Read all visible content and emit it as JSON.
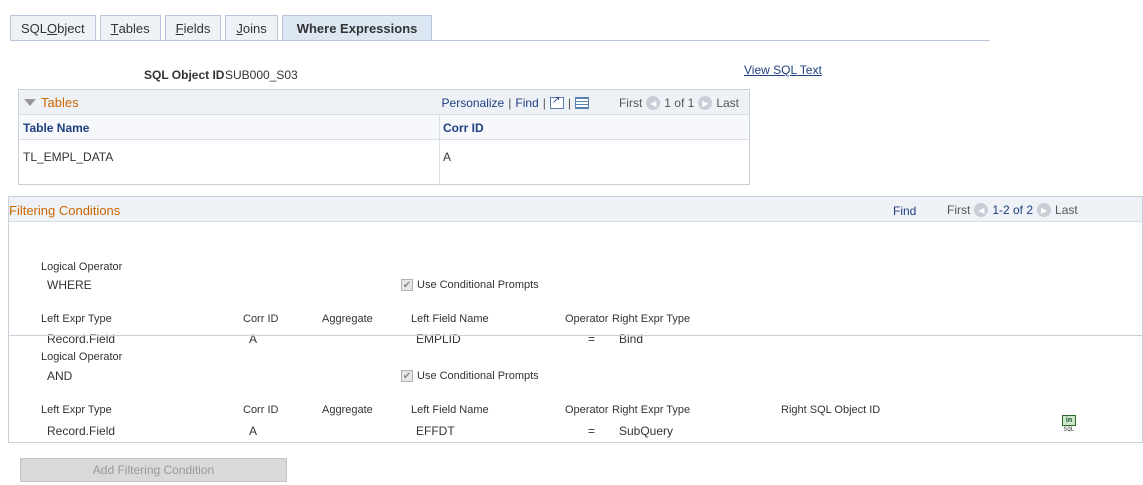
{
  "tabs": [
    {
      "pre": "SQL ",
      "u": "O",
      "post": "bject"
    },
    {
      "pre": "",
      "u": "T",
      "post": "ables"
    },
    {
      "pre": "",
      "u": "F",
      "post": "ields"
    },
    {
      "pre": "",
      "u": "J",
      "post": "oins"
    },
    {
      "pre": "",
      "u": "",
      "post": "Where Expressions"
    }
  ],
  "header": {
    "sql_object_id_label": "SQL Object ID",
    "sql_object_id_value": "SUB000_S03",
    "view_sql_text": "View SQL Text"
  },
  "tables_grid": {
    "title": "Tables",
    "personalize": "Personalize",
    "find": "Find",
    "first": "First",
    "range": "1 of 1",
    "last": "Last",
    "columns": [
      "Table Name",
      "Corr ID"
    ],
    "rows": [
      [
        "TL_EMPL_DATA",
        "A"
      ]
    ]
  },
  "filtering": {
    "title": "Filtering Conditions",
    "find": "Find",
    "first": "First",
    "range": "1-2 of 2",
    "last": "Last",
    "labels": {
      "logical_operator": "Logical Operator",
      "use_conditional_prompts": "Use Conditional Prompts",
      "left_expr_type": "Left Expr Type",
      "corr_id": "Corr ID",
      "aggregate": "Aggregate",
      "left_field_name": "Left Field Name",
      "operator": "Operator",
      "right_expr_type": "Right Expr Type",
      "right_sql_object_id": "Right SQL Object ID"
    },
    "conditions": [
      {
        "logical_operator": "WHERE",
        "left_expr_type": "Record.Field",
        "corr_id": "A",
        "left_field_name": "EMPLID",
        "operator": "=",
        "right_expr_type": "Bind"
      },
      {
        "logical_operator": "AND",
        "left_expr_type": "Record.Field",
        "corr_id": "A",
        "left_field_name": "EFFDT",
        "operator": "=",
        "right_expr_type": "SubQuery"
      }
    ]
  },
  "sql_icon": {
    "top": "in",
    "bottom": "SQL"
  },
  "add_button": "Add Filtering Condition"
}
